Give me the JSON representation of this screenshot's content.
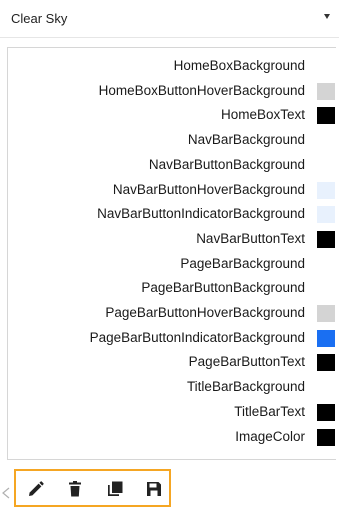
{
  "theme_select": {
    "value": "Clear Sky"
  },
  "colors": [
    {
      "label": "HomeBoxBackground",
      "swatch": null
    },
    {
      "label": "HomeBoxButtonHoverBackground",
      "swatch": "#d4d4d4"
    },
    {
      "label": "HomeBoxText",
      "swatch": "#000000"
    },
    {
      "label": "NavBarBackground",
      "swatch": null
    },
    {
      "label": "NavBarButtonBackground",
      "swatch": null
    },
    {
      "label": "NavBarButtonHoverBackground",
      "swatch": "#e8f1fd"
    },
    {
      "label": "NavBarButtonIndicatorBackground",
      "swatch": "#e8f1fd"
    },
    {
      "label": "NavBarButtonText",
      "swatch": "#000000"
    },
    {
      "label": "PageBarBackground",
      "swatch": null
    },
    {
      "label": "PageBarButtonBackground",
      "swatch": null
    },
    {
      "label": "PageBarButtonHoverBackground",
      "swatch": "#d4d4d4"
    },
    {
      "label": "PageBarButtonIndicatorBackground",
      "swatch": "#1a6ff2"
    },
    {
      "label": "PageBarButtonText",
      "swatch": "#000000"
    },
    {
      "label": "TitleBarBackground",
      "swatch": null
    },
    {
      "label": "TitleBarText",
      "swatch": "#000000"
    },
    {
      "label": "ImageColor",
      "swatch": "#000000"
    }
  ],
  "toolbar": {
    "buttons": [
      {
        "name": "edit",
        "icon": "pencil-icon"
      },
      {
        "name": "delete",
        "icon": "trash-icon"
      },
      {
        "name": "copy",
        "icon": "copy-icon"
      },
      {
        "name": "save",
        "icon": "save-icon"
      }
    ]
  },
  "colors_accent": {
    "toolbar_border": "#f5a623"
  }
}
